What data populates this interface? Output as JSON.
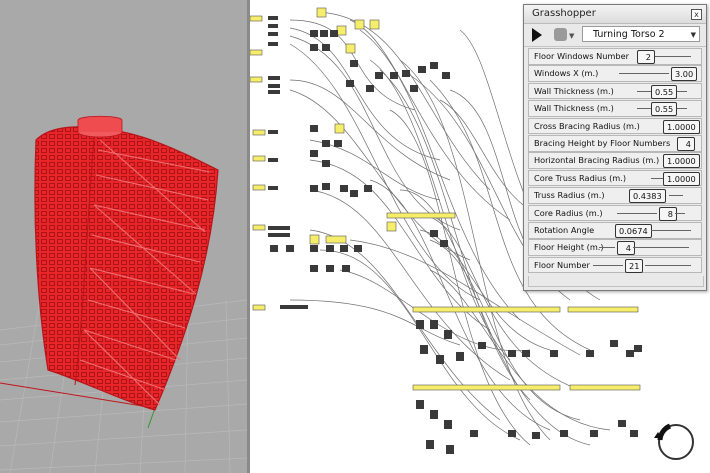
{
  "app": {
    "name": "Grasshopper"
  },
  "panel": {
    "title": "Grasshopper",
    "close_glyph": "x",
    "preset_selected": "Turning Torso 2",
    "sliders": [
      {
        "label": "Floor Windows Number",
        "value": "2"
      },
      {
        "label": "Windows X (m.)",
        "value": "3.00"
      },
      {
        "label": "Wall Thickness (m.)",
        "value": "0.55"
      },
      {
        "label": "Wall Thickness (m.)",
        "value": "0.55"
      },
      {
        "label": "Cross Bracing Radius (m.)",
        "value": "1.0000"
      },
      {
        "label": "Bracing Height by Floor Numbers",
        "value": "4"
      },
      {
        "label": "Horizontal Bracing Radius (m.)",
        "value": "1.0000"
      },
      {
        "label": "Core Truss Radius (m.)",
        "value": "1.0000"
      },
      {
        "label": "Truss Radius (m.)",
        "value": "0.4383"
      },
      {
        "label": "Core Radius (m.)",
        "value": "8"
      },
      {
        "label": "Rotation Angle",
        "value": "0.0674"
      },
      {
        "label": "Floor Height (m.)",
        "value": "4"
      },
      {
        "label": "Floor Number",
        "value": "21"
      }
    ]
  },
  "viewport": {
    "model_color": "#e8262a",
    "background": "#a9a9a9"
  },
  "icons": [
    "play-icon",
    "tag-icon",
    "close-icon",
    "dropdown-caret-icon",
    "navigation-compass-icon"
  ]
}
